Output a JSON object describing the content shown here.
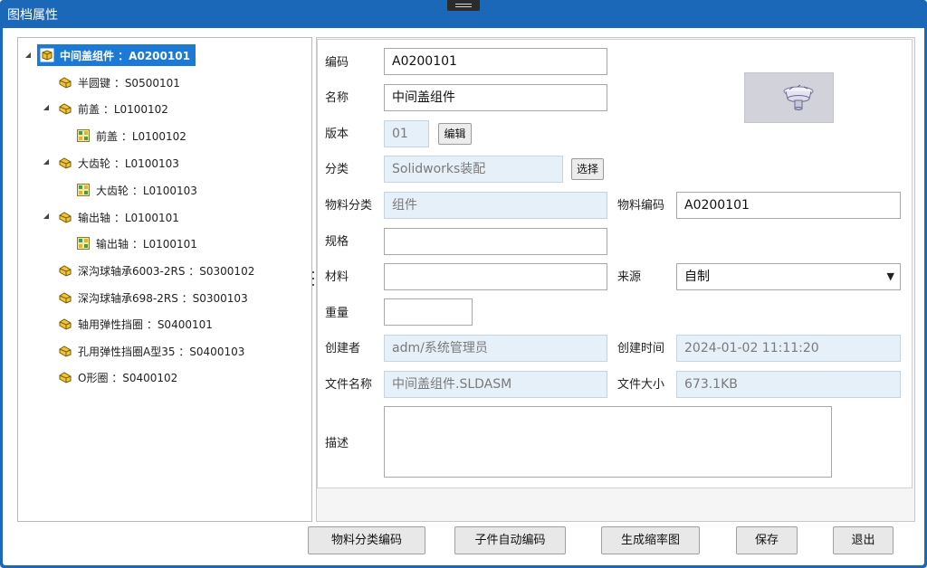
{
  "window": {
    "title": "图档属性"
  },
  "tree": {
    "items": [
      {
        "label": "中间盖组件 ：A0200101",
        "icon": "assembly-icon",
        "expanded": true,
        "selected": true
      },
      {
        "label": "半圆键 ：S0500101",
        "icon": "assembly-icon"
      },
      {
        "label": "前盖 ：L0100102",
        "icon": "assembly-icon",
        "expanded": true
      },
      {
        "label": "前盖 ：L0100102",
        "icon": "part-icon"
      },
      {
        "label": "大齿轮 ：L0100103",
        "icon": "assembly-icon",
        "expanded": true
      },
      {
        "label": "大齿轮 ：L0100103",
        "icon": "part-icon"
      },
      {
        "label": "输出轴 ：L0100101",
        "icon": "assembly-icon",
        "expanded": true
      },
      {
        "label": "输出轴 ：L0100101",
        "icon": "part-icon"
      },
      {
        "label": "深沟球轴承6003-2RS ：S0300102",
        "icon": "assembly-icon"
      },
      {
        "label": "深沟球轴承698-2RS ：S0300103",
        "icon": "assembly-icon"
      },
      {
        "label": "轴用弹性挡圈 ：S0400101",
        "icon": "assembly-icon"
      },
      {
        "label": "孔用弹性挡圈A型35 ：S0400103",
        "icon": "assembly-icon"
      },
      {
        "label": "O形圈 ：S0400102",
        "icon": "assembly-icon"
      }
    ]
  },
  "form": {
    "code": {
      "label": "编码",
      "value": "A0200101"
    },
    "name": {
      "label": "名称",
      "value": "中间盖组件"
    },
    "version": {
      "label": "版本",
      "value": "01",
      "button": "编辑"
    },
    "category": {
      "label": "分类",
      "value": "Solidworks装配",
      "button": "选择"
    },
    "material_category": {
      "label": "物料分类",
      "value": "组件"
    },
    "material_code": {
      "label": "物料编码",
      "value": "A0200101"
    },
    "spec": {
      "label": "规格",
      "value": ""
    },
    "material": {
      "label": "材料",
      "value": ""
    },
    "source": {
      "label": "来源",
      "value": "自制"
    },
    "weight": {
      "label": "重量",
      "value": ""
    },
    "creator": {
      "label": "创建者",
      "value": "adm/系统管理员"
    },
    "created_time": {
      "label": "创建时间",
      "value": "2024-01-02 11:11:20"
    },
    "file_name": {
      "label": "文件名称",
      "value": "中间盖组件.SLDASM"
    },
    "file_size": {
      "label": "文件大小",
      "value": "673.1KB"
    },
    "description": {
      "label": "描述",
      "value": ""
    }
  },
  "buttons": {
    "material_category_code": "物料分类编码",
    "child_auto_code": "子件自动编码",
    "generate_thumbnail": "生成缩率图",
    "save": "保存",
    "exit": "退出"
  },
  "colors": {
    "titlebar": "#1b67b8",
    "selection": "#1c7ad6",
    "readonly_field": "#e6f0f8"
  }
}
